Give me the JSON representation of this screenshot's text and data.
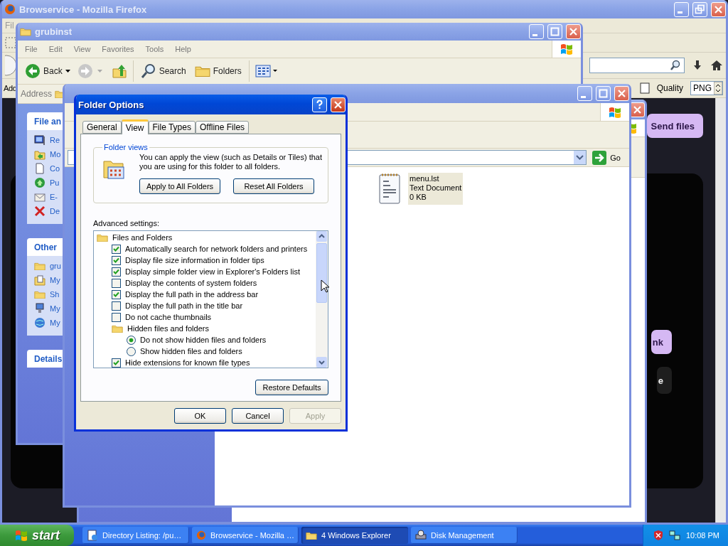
{
  "firefox": {
    "title": "Browservice - Mozilla Firefox",
    "menu_fragment": "Fil",
    "address_fragment": "Add",
    "quality_label": "Quality",
    "quality_value": "PNG",
    "page_buttons": [
      {
        "label": "Send files",
        "kind": "light"
      },
      {
        "label": "nk",
        "kind": "light"
      },
      {
        "label": "e",
        "kind": "dark"
      }
    ]
  },
  "explorer_back": {
    "title": "grubinst",
    "menu": [
      "File",
      "Edit",
      "View",
      "Favorites",
      "Tools",
      "Help"
    ],
    "back": "Back",
    "search": "Search",
    "folders": "Folders",
    "address_label": "Address",
    "panes": [
      {
        "title": "File an",
        "items": [
          {
            "label": "Re",
            "kind": "publish"
          },
          {
            "label": "Mo",
            "kind": "move"
          },
          {
            "label": "Co",
            "kind": "copy"
          },
          {
            "label": "Pu",
            "kind": "web"
          },
          {
            "label": "E-",
            "kind": "mail"
          },
          {
            "label": "De",
            "kind": "delete"
          }
        ]
      },
      {
        "title": "Other",
        "items": [
          {
            "label": "gru",
            "kind": "folder"
          },
          {
            "label": "My",
            "kind": "docs"
          },
          {
            "label": "Sh",
            "kind": "folder"
          },
          {
            "label": "My",
            "kind": "computer"
          },
          {
            "label": "My",
            "kind": "network"
          }
        ]
      },
      {
        "title": "Details"
      }
    ]
  },
  "explorer_front": {
    "go": "Go",
    "files": [
      {
        "name": "menu.lst",
        "type": "Text Document",
        "size": "0 KB",
        "selected": true
      }
    ]
  },
  "dialog": {
    "title": "Folder Options",
    "tabs": [
      {
        "label": "General",
        "selected": false
      },
      {
        "label": "View",
        "selected": true
      },
      {
        "label": "File Types",
        "selected": false
      },
      {
        "label": "Offline Files",
        "selected": false
      }
    ],
    "folder_views": {
      "legend": "Folder views",
      "text": "You can apply the view (such as Details or Tiles) that you are using for this folder to all folders.",
      "buttons": [
        "Apply to All Folders",
        "Reset All Folders"
      ]
    },
    "advanced_label": "Advanced settings:",
    "settings": [
      {
        "kind": "folder",
        "label": "Files and Folders",
        "children": [
          {
            "kind": "checkbox",
            "label": "Automatically search for network folders and printers",
            "checked": true
          },
          {
            "kind": "checkbox",
            "label": "Display file size information in folder tips",
            "checked": true
          },
          {
            "kind": "checkbox",
            "label": "Display simple folder view in Explorer's Folders list",
            "checked": true
          },
          {
            "kind": "checkbox",
            "label": "Display the contents of system folders",
            "checked": false
          },
          {
            "kind": "checkbox",
            "label": "Display the full path in the address bar",
            "checked": true
          },
          {
            "kind": "checkbox",
            "label": "Display the full path in the title bar",
            "checked": false
          },
          {
            "kind": "checkbox",
            "label": "Do not cache thumbnails",
            "checked": false
          },
          {
            "kind": "folder",
            "label": "Hidden files and folders",
            "children": [
              {
                "kind": "radio",
                "label": "Do not show hidden files and folders",
                "selected": true
              },
              {
                "kind": "radio",
                "label": "Show hidden files and folders",
                "selected": false
              }
            ]
          },
          {
            "kind": "checkbox",
            "label": "Hide extensions for known file types",
            "checked": true
          }
        ]
      }
    ],
    "restore": "Restore Defaults",
    "buttons": [
      {
        "label": "OK",
        "disabled": false
      },
      {
        "label": "Cancel",
        "disabled": false
      },
      {
        "label": "Apply",
        "disabled": true
      }
    ]
  },
  "taskbar": {
    "start": "start",
    "tasks": [
      {
        "label": "Directory Listing: /pu…",
        "kind": "page",
        "selected": false
      },
      {
        "label": "Browservice - Mozilla …",
        "kind": "firefox",
        "selected": false
      },
      {
        "label": "4 Windows Explorer",
        "kind": "folder",
        "selected": true
      },
      {
        "label": "Disk Management",
        "kind": "disk",
        "selected": false
      }
    ],
    "clock": "10:08 PM"
  }
}
